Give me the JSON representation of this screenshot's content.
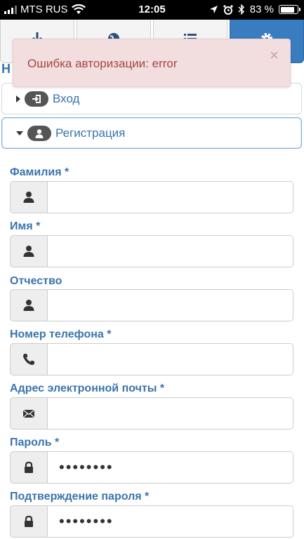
{
  "status_bar": {
    "carrier": "MTS RUS",
    "time": "12:05",
    "battery_percent": 83,
    "battery_label": "83 %"
  },
  "nav_tabs": [
    {
      "icon": "download-icon",
      "active": false
    },
    {
      "icon": "globe-icon",
      "active": false
    },
    {
      "icon": "list-icon",
      "active": false
    },
    {
      "icon": "gear-icon",
      "active": true
    }
  ],
  "page_heading": "Н",
  "alert": {
    "message": "Ошибка авторизации: error",
    "close_label": "×"
  },
  "accordion": {
    "login_label": "Вход",
    "register_label": "Регистрация"
  },
  "form": {
    "fields": [
      {
        "label": "Фамилия *",
        "icon": "user-icon",
        "value": ""
      },
      {
        "label": "Имя *",
        "icon": "user-icon",
        "value": ""
      },
      {
        "label": "Отчество",
        "icon": "user-icon",
        "value": ""
      },
      {
        "label": "Номер телефона *",
        "icon": "phone-icon",
        "value": ""
      },
      {
        "label": "Адрес электронной почты *",
        "icon": "envelope-icon",
        "value": ""
      },
      {
        "label": "Пароль *",
        "icon": "lock-icon",
        "value": "••••••••"
      },
      {
        "label": "Подтверждение пароля *",
        "icon": "lock-icon",
        "value": "••••••••"
      }
    ]
  },
  "colors": {
    "accent": "#3a74ad",
    "active_tab": "#3a7cc0",
    "alert_bg": "#f2dede",
    "alert_text": "#a94442"
  }
}
